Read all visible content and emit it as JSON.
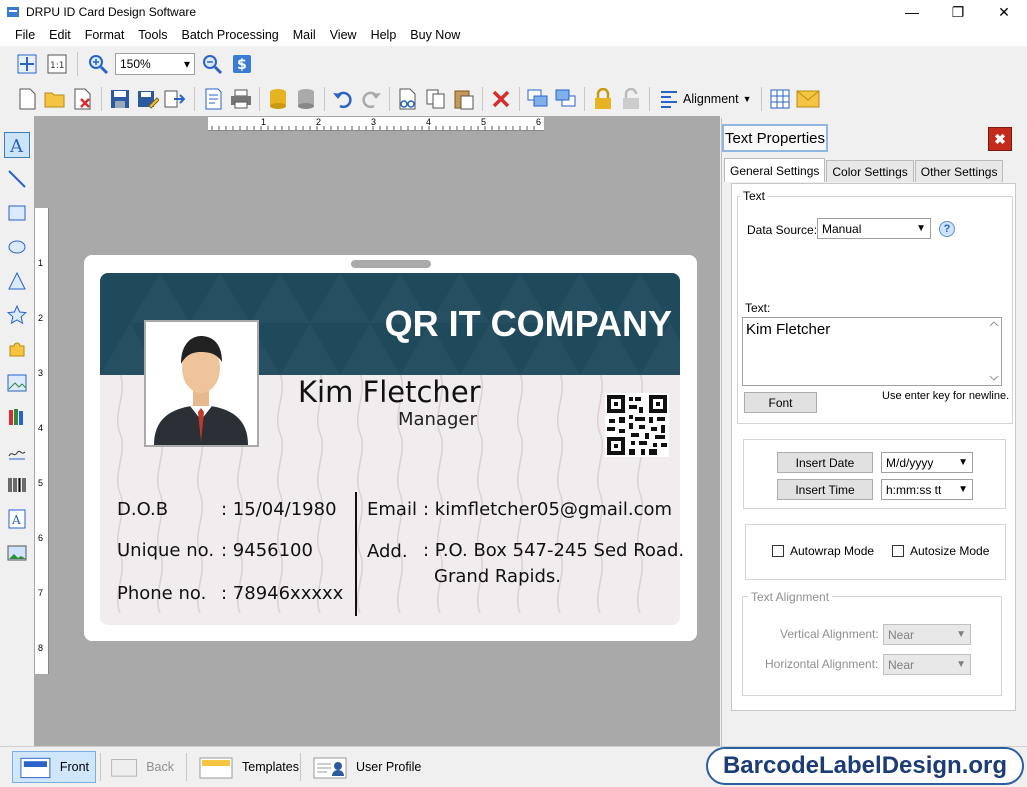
{
  "window": {
    "title": "DRPU ID Card Design Software"
  },
  "menu": [
    "File",
    "Edit",
    "Format",
    "Tools",
    "Batch Processing",
    "Mail",
    "View",
    "Help",
    "Buy Now"
  ],
  "toolbar": {
    "zoom_value": "150%",
    "alignment_label": "Alignment"
  },
  "ruler": {
    "h": [
      "1",
      "2",
      "3",
      "4",
      "5",
      "6"
    ],
    "v": [
      "1",
      "2",
      "3",
      "4",
      "5",
      "6",
      "7",
      "8"
    ]
  },
  "card": {
    "company": "QR IT COMPANY",
    "name": "Kim Fletcher",
    "role": "Manager",
    "dob_label": "D.O.B",
    "dob_value": ": 15/04/1980",
    "unique_label": "Unique no.",
    "unique_value": ": 9456100",
    "phone_label": "Phone no.",
    "phone_value": ": 78946xxxxx",
    "email_label": "Email",
    "email_value": ": kimfletcher05@gmail.com",
    "address_label": "Add.",
    "address_line1": ": P.O. Box 547-245 Sed Road.",
    "address_line2": "Grand Rapids.",
    "colors": {
      "header": "#1e4a5c",
      "body": "#f1edee"
    }
  },
  "props": {
    "title": "Text Properties",
    "tabs": [
      "General Settings",
      "Color Settings",
      "Other Settings"
    ],
    "text_group": "Text",
    "data_source_label": "Data Source:",
    "data_source_value": "Manual",
    "text_label": "Text:",
    "text_value": "Kim Fletcher",
    "font_button": "Font",
    "newline_hint": "Use enter key for newline.",
    "insert_date_button": "Insert Date",
    "date_format": "M/d/yyyy",
    "insert_time_button": "Insert Time",
    "time_format": "h:mm:ss tt",
    "autowrap_label": "Autowrap Mode",
    "autosize_label": "Autosize Mode",
    "alignment_group": "Text Alignment",
    "vertical_label": "Vertical Alignment:",
    "vertical_value": "Near",
    "horizontal_label": "Horizontal  Alignment:",
    "horizontal_value": "Near"
  },
  "bottom": {
    "front": "Front",
    "back": "Back",
    "templates": "Templates",
    "user_profile": "User Profile"
  },
  "brand": "BarcodeLabelDesign.org"
}
